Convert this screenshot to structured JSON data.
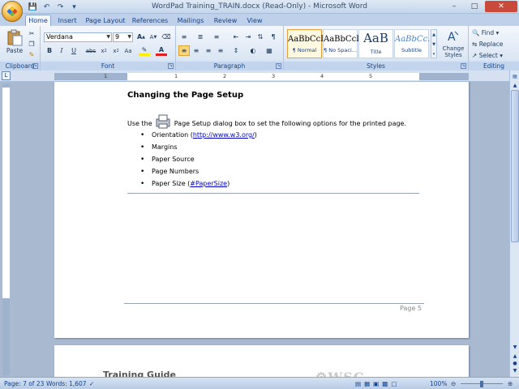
{
  "window": {
    "title": "WordPad Training_TRAIN.docx (Read-Only) - Microsoft Word"
  },
  "tabs": [
    "Home",
    "Insert",
    "Page Layout",
    "References",
    "Mailings",
    "Review",
    "View"
  ],
  "ribbon": {
    "clipboard": {
      "paste_label": "Paste",
      "group_label": "Clipboard"
    },
    "font": {
      "font_name": "Verdana",
      "font_size": "9",
      "group_label": "Font"
    },
    "paragraph": {
      "group_label": "Paragraph"
    },
    "styles": {
      "items": [
        {
          "preview": "AaBbCcI",
          "name": "¶ Normal"
        },
        {
          "preview": "AaBbCcI",
          "name": "¶ No Spaci..."
        },
        {
          "preview": "AaB",
          "name": "Title"
        },
        {
          "preview": "AaBbCc.",
          "name": "Subtitle"
        }
      ],
      "change_styles_label": "Change Styles",
      "group_label": "Styles"
    },
    "editing": {
      "find": "Find",
      "replace": "Replace",
      "select": "Select",
      "group_label": "Editing"
    }
  },
  "ruler": {
    "numbers": [
      "1",
      "1",
      "2",
      "3",
      "4",
      "5"
    ]
  },
  "document": {
    "heading": "Changing the Page Setup",
    "intro_before": "Use the",
    "intro_after": "Page Setup dialog box to set the following options for the printed page.",
    "bullets": [
      {
        "text": "Orientation (",
        "link": "http://www.w3.org/",
        "suffix": ")"
      },
      {
        "text": "Margins",
        "link": "",
        "suffix": ""
      },
      {
        "text": "Paper Source",
        "link": "",
        "suffix": ""
      },
      {
        "text": "Page Numbers",
        "link": "",
        "suffix": ""
      },
      {
        "text": "Paper Size (",
        "link": "#PaperSize",
        "suffix": ")"
      }
    ],
    "page_number": "Page 5",
    "next_page_title": "Training Guide",
    "next_page_logo": "WSC"
  },
  "status": {
    "page": "Page: 7 of 23",
    "words": "Words: 1,607",
    "zoom": "100%"
  }
}
